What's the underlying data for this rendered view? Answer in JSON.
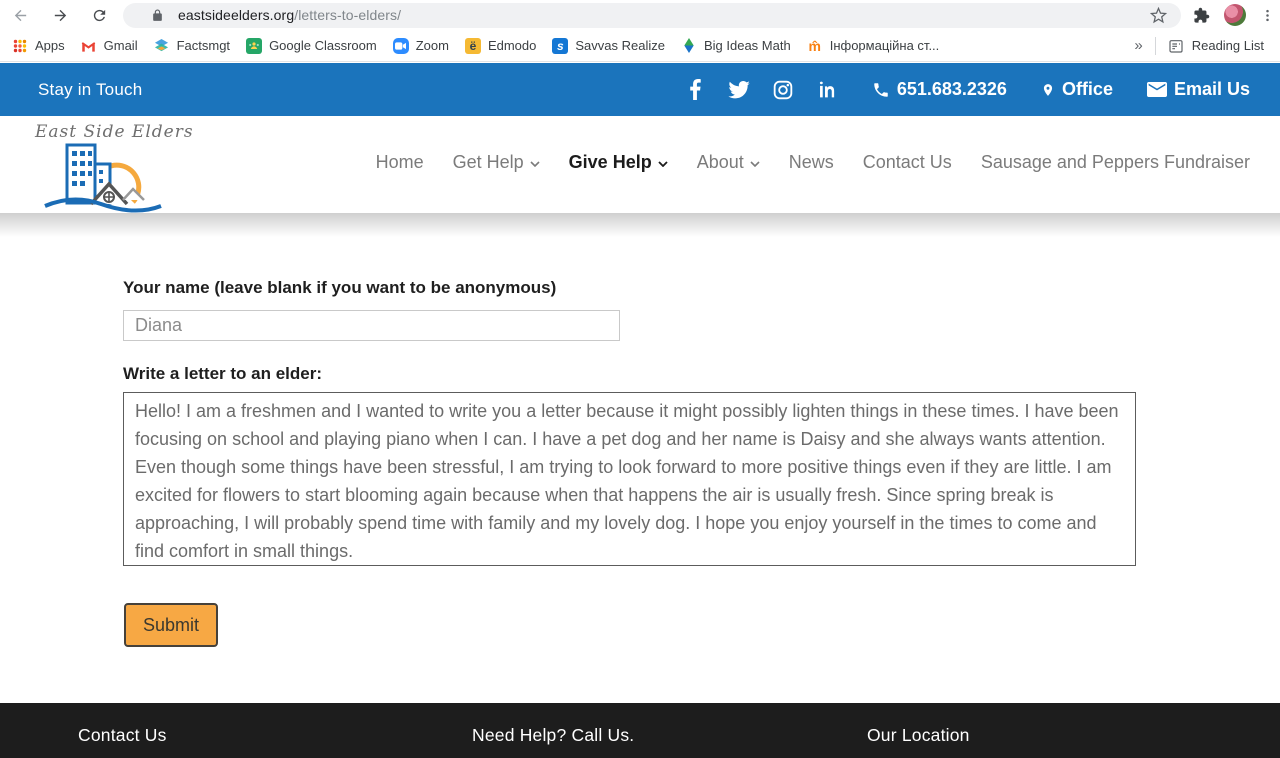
{
  "browser": {
    "url_host": "eastsideelders.org",
    "url_path": "/letters-to-elders/",
    "bookmarks": [
      {
        "label": "Apps"
      },
      {
        "label": "Gmail"
      },
      {
        "label": "Factsmgt"
      },
      {
        "label": "Google Classroom"
      },
      {
        "label": "Zoom"
      },
      {
        "label": "Edmodo"
      },
      {
        "label": "Savvas Realize"
      },
      {
        "label": "Big Ideas Math"
      },
      {
        "label": "Інформаційна ст..."
      }
    ],
    "overflow_chevron": "»",
    "reading_list_label": "Reading List"
  },
  "topbar": {
    "stay_in_touch": "Stay in Touch",
    "phone": "651.683.2326",
    "office_label": "Office",
    "email_label": "Email Us"
  },
  "header": {
    "logo_text": "East Side Elders",
    "nav": [
      {
        "label": "Home"
      },
      {
        "label": "Get Help"
      },
      {
        "label": "Give Help"
      },
      {
        "label": "About"
      },
      {
        "label": "News"
      },
      {
        "label": "Contact Us"
      },
      {
        "label": "Sausage and Peppers Fundraiser"
      }
    ],
    "active_item": "Give Help"
  },
  "form": {
    "name_label": "Your name (leave blank if you want to be anonymous)",
    "name_value": "Diana",
    "letter_label": "Write a letter to an elder:",
    "letter_value": "Hello! I am a freshmen and I wanted to write you a letter because it might possibly lighten things in these times. I have been focusing on school and playing piano when I can. I have a pet dog and her name is Daisy and she always wants attention. Even though some things have been stressful, I am trying to look forward to more positive things even if they are little. I am excited for flowers to start blooming again because when that happens the air is usually fresh. Since spring break is approaching, I will probably spend time with family and my lovely dog. I hope you enjoy yourself in the times to come and find comfort in small things.",
    "submit_label": "Submit"
  },
  "footer": {
    "col1_heading": "Contact Us",
    "col2_heading": "Need Help?  Call Us.",
    "col3_heading": "Our Location"
  },
  "colors": {
    "topbar_blue": "#1b74bc",
    "submit_orange": "#f7a844",
    "footer_bg": "#1d1d1d",
    "logo_blue": "#1b6cb5",
    "logo_orange": "#f5a93e"
  }
}
